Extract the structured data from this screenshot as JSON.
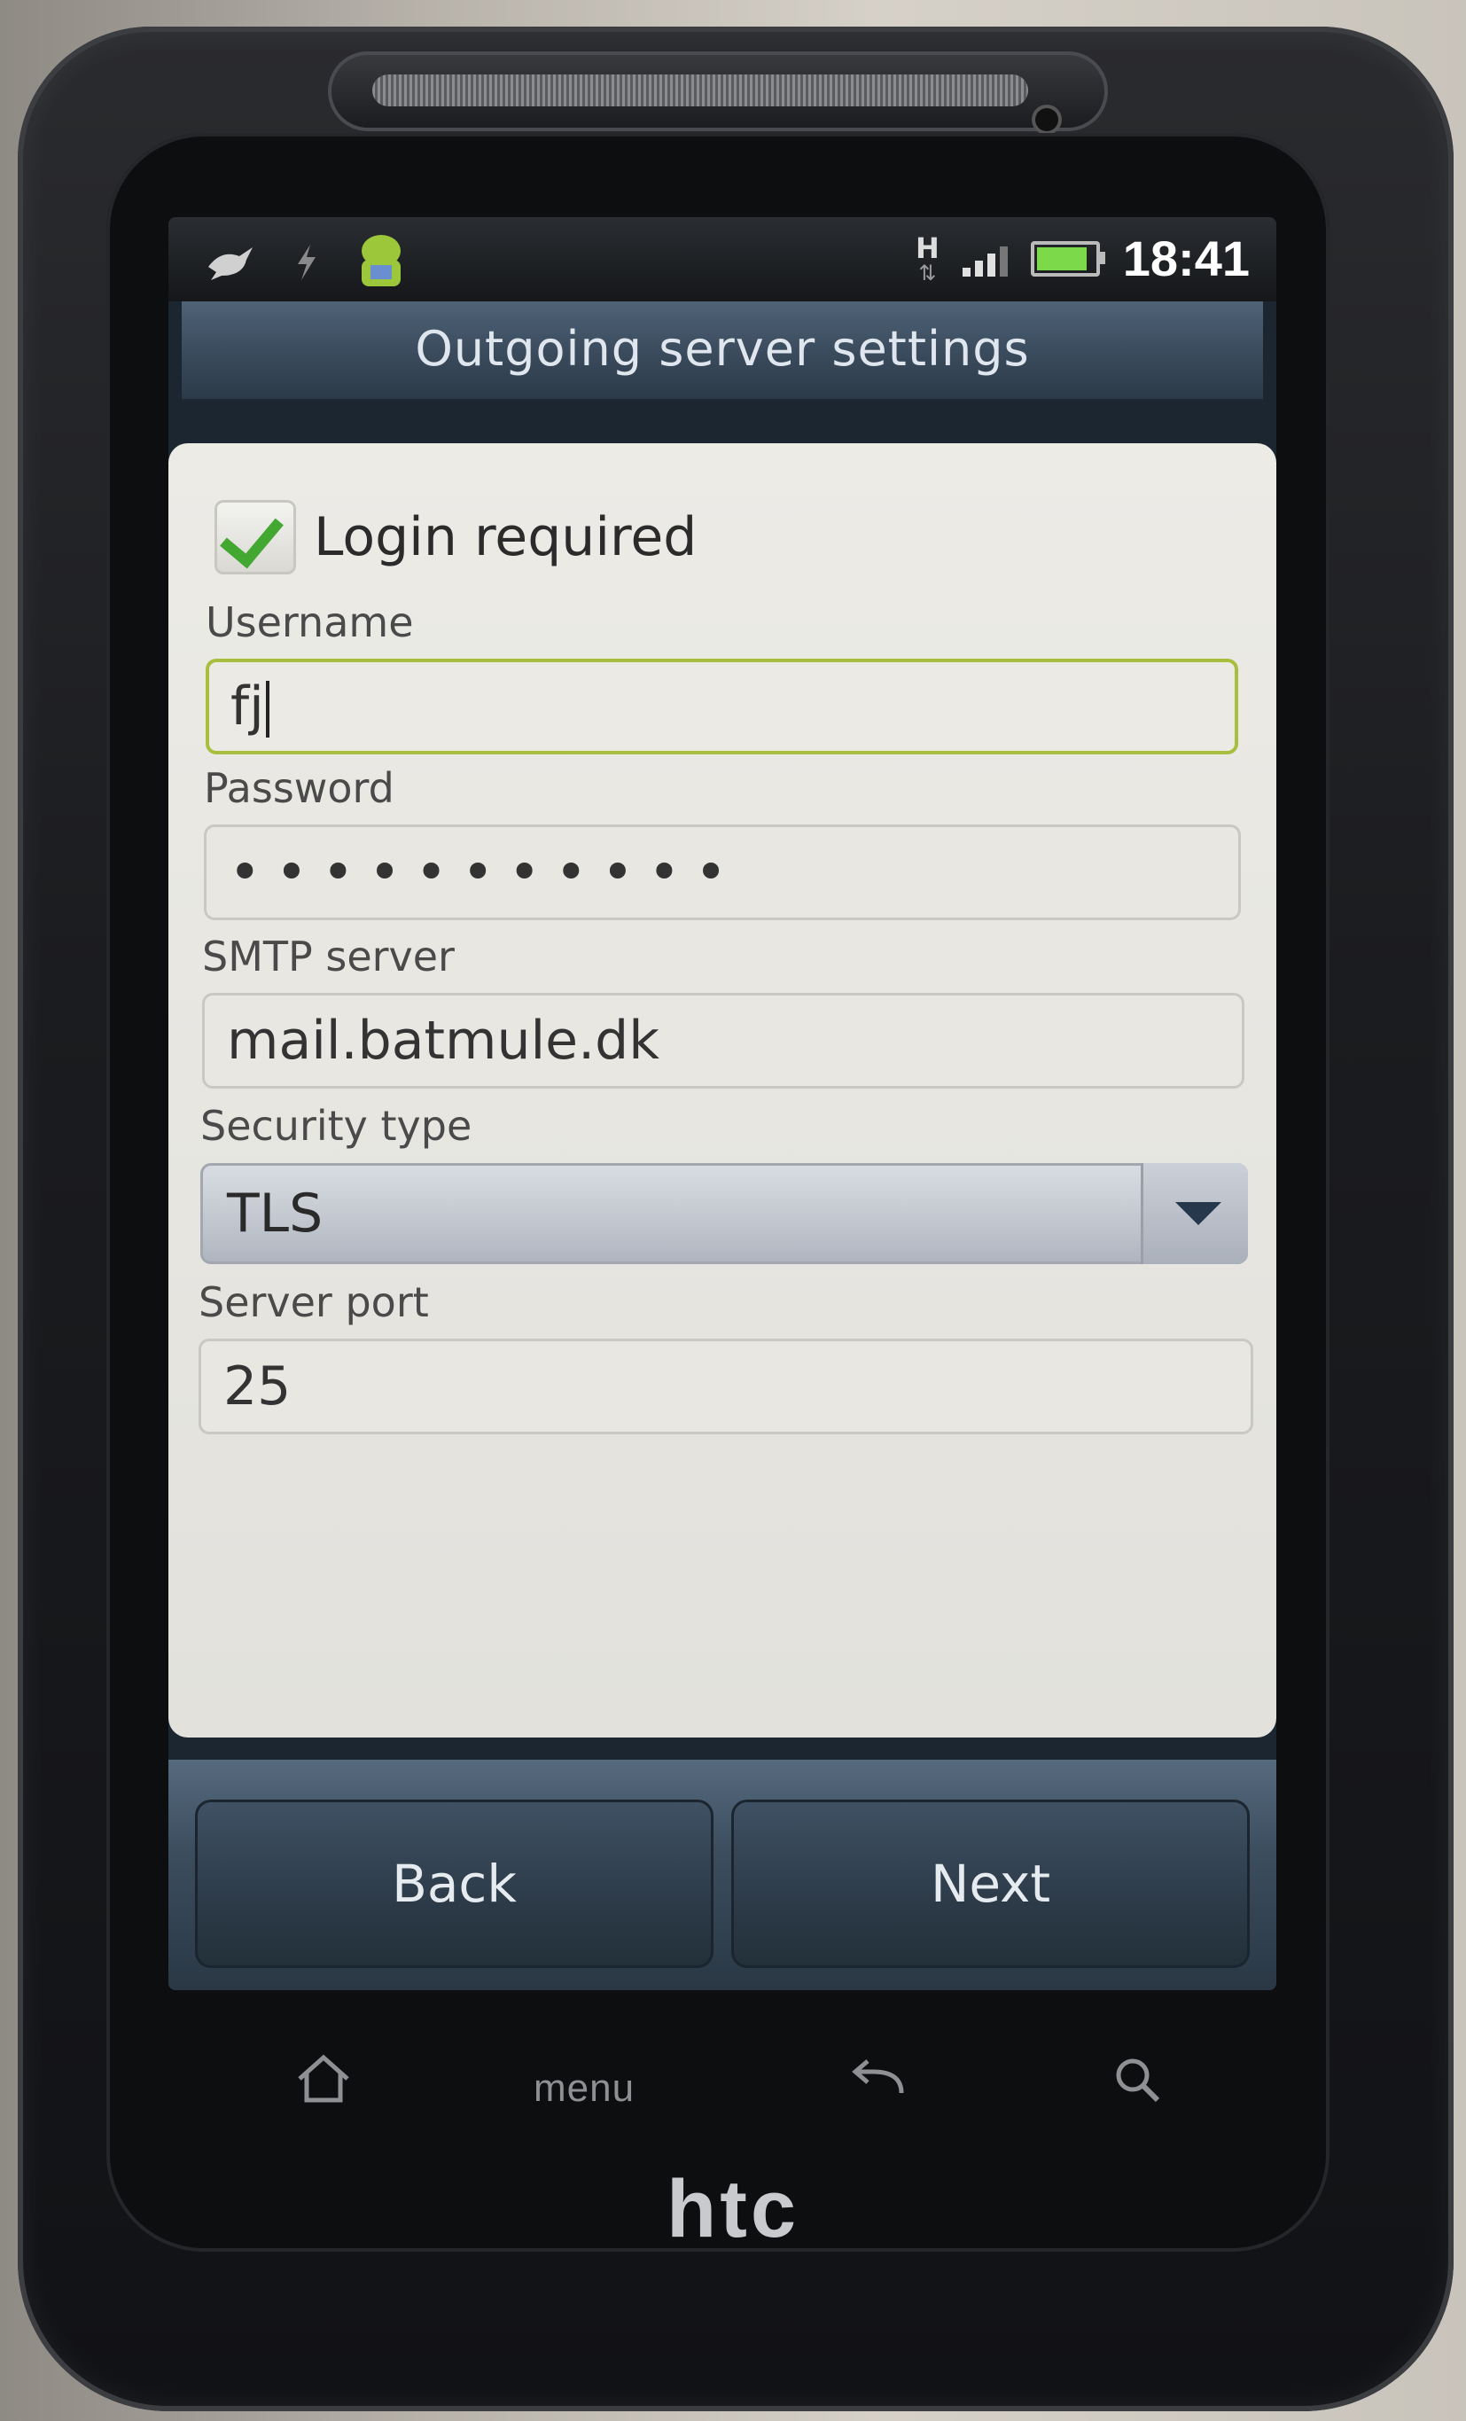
{
  "status_bar": {
    "network_type": "H",
    "time": "18:41",
    "battery_color": "#7bd94a",
    "icons": [
      "bird-icon",
      "usb-icon",
      "android-icon",
      "data-arrows-icon",
      "signal-icon",
      "battery-icon"
    ]
  },
  "screen": {
    "title": "Outgoing server settings"
  },
  "form": {
    "login_required_label": "Login required",
    "login_required_checked": true,
    "username_label": "Username",
    "username_value": "fj",
    "password_label": "Password",
    "password_value": "•••••••••••",
    "smtp_label": "SMTP server",
    "smtp_value": "mail.batmule.dk",
    "security_label": "Security type",
    "security_value": "TLS",
    "port_label": "Server port",
    "port_value": "25",
    "accent_focus_color": "#a8be3e",
    "check_color": "#43a831"
  },
  "buttons": {
    "back_label": "Back",
    "next_label": "Next"
  },
  "hardware_keys": {
    "home_icon": "home-icon",
    "menu_label": "menu",
    "back_icon": "back-icon",
    "search_icon": "search-icon",
    "brand": "htc"
  }
}
